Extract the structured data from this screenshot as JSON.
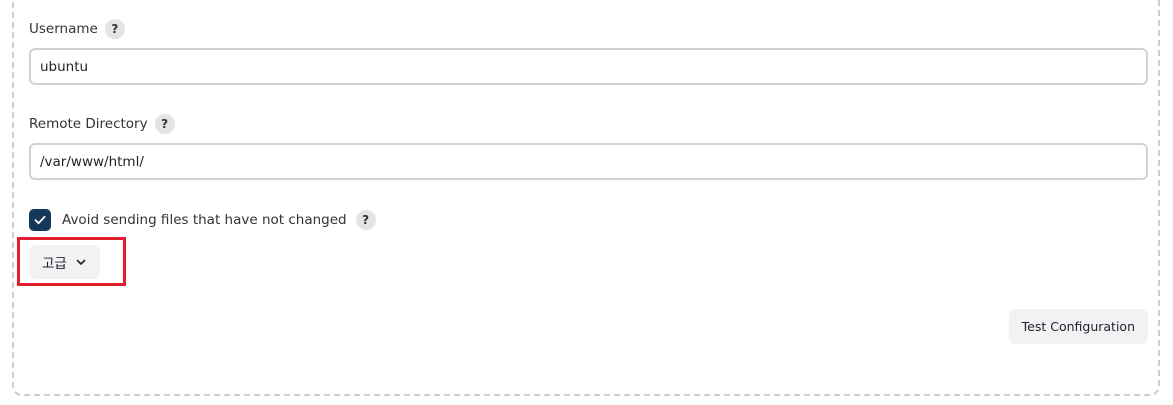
{
  "form": {
    "username": {
      "label": "Username",
      "help": "?",
      "value": "ubuntu"
    },
    "remote_directory": {
      "label": "Remote Directory",
      "help": "?",
      "value": "/var/www/html/"
    },
    "avoid_sending": {
      "label": "Avoid sending files that have not changed",
      "help": "?",
      "checked": true
    },
    "advanced_button": {
      "label": "고급",
      "icon": "chevron-down-icon"
    },
    "test_button": {
      "label": "Test Configuration"
    }
  },
  "colors": {
    "checkbox": "#14385a",
    "highlight": "#e0202e",
    "button_bg": "#f2f2f4",
    "input_border": "#cfd3d7"
  }
}
